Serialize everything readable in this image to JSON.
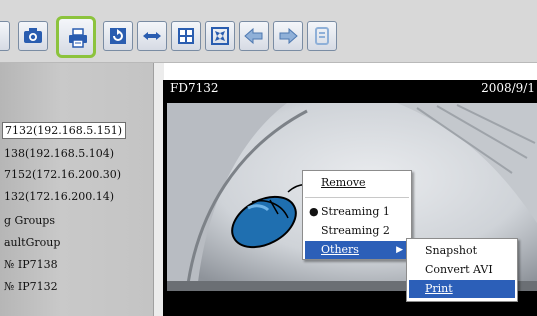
{
  "toolbar": {
    "buttons": [
      {
        "icon": "camera-icon",
        "label": "Snapshot"
      },
      {
        "icon": "printer-icon",
        "label": "Print",
        "highlighted": true
      },
      {
        "icon": "refresh-icon",
        "label": "Refresh"
      },
      {
        "icon": "fullscreen-icon",
        "label": "Full screen"
      },
      {
        "icon": "layout-grid-icon",
        "label": "Layout"
      },
      {
        "icon": "fit-window-icon",
        "label": "Fit"
      },
      {
        "icon": "arrow-left-icon",
        "label": "Back"
      },
      {
        "icon": "arrow-right-icon",
        "label": "Forward"
      },
      {
        "icon": "tool-icon",
        "label": "Settings"
      }
    ]
  },
  "tree": {
    "items": [
      {
        "text": "7132(192.168.5.151)",
        "selected": true
      },
      {
        "text": "138(192.168.5.104)",
        "selected": false
      },
      {
        "text": "7152(172.16.200.30)",
        "selected": false
      },
      {
        "text": "132(172.16.200.14)",
        "selected": false
      },
      {
        "text": "g Groups",
        "selected": false
      },
      {
        "text": "aultGroup",
        "selected": false
      },
      {
        "text": "№ IP7138",
        "selected": false
      },
      {
        "text": "№ IP7132",
        "selected": false
      }
    ]
  },
  "video": {
    "title": "FD7132",
    "date": "2008/9/1"
  },
  "context_menu": {
    "items": [
      {
        "label": "Remove",
        "checked": false
      },
      {
        "label": "Streaming 1",
        "checked": true
      },
      {
        "label": "Streaming 2",
        "checked": false
      },
      {
        "label": "Others",
        "has_submenu": true,
        "active": true
      }
    ],
    "submenu": [
      {
        "label": "Snapshot"
      },
      {
        "label": "Convert AVI"
      },
      {
        "label": "Print",
        "active": true
      }
    ]
  },
  "colors": {
    "highlight_border": "#8cc33d",
    "menu_active": "#2c5fb8",
    "mouse_icon": "#1f6fb0"
  }
}
